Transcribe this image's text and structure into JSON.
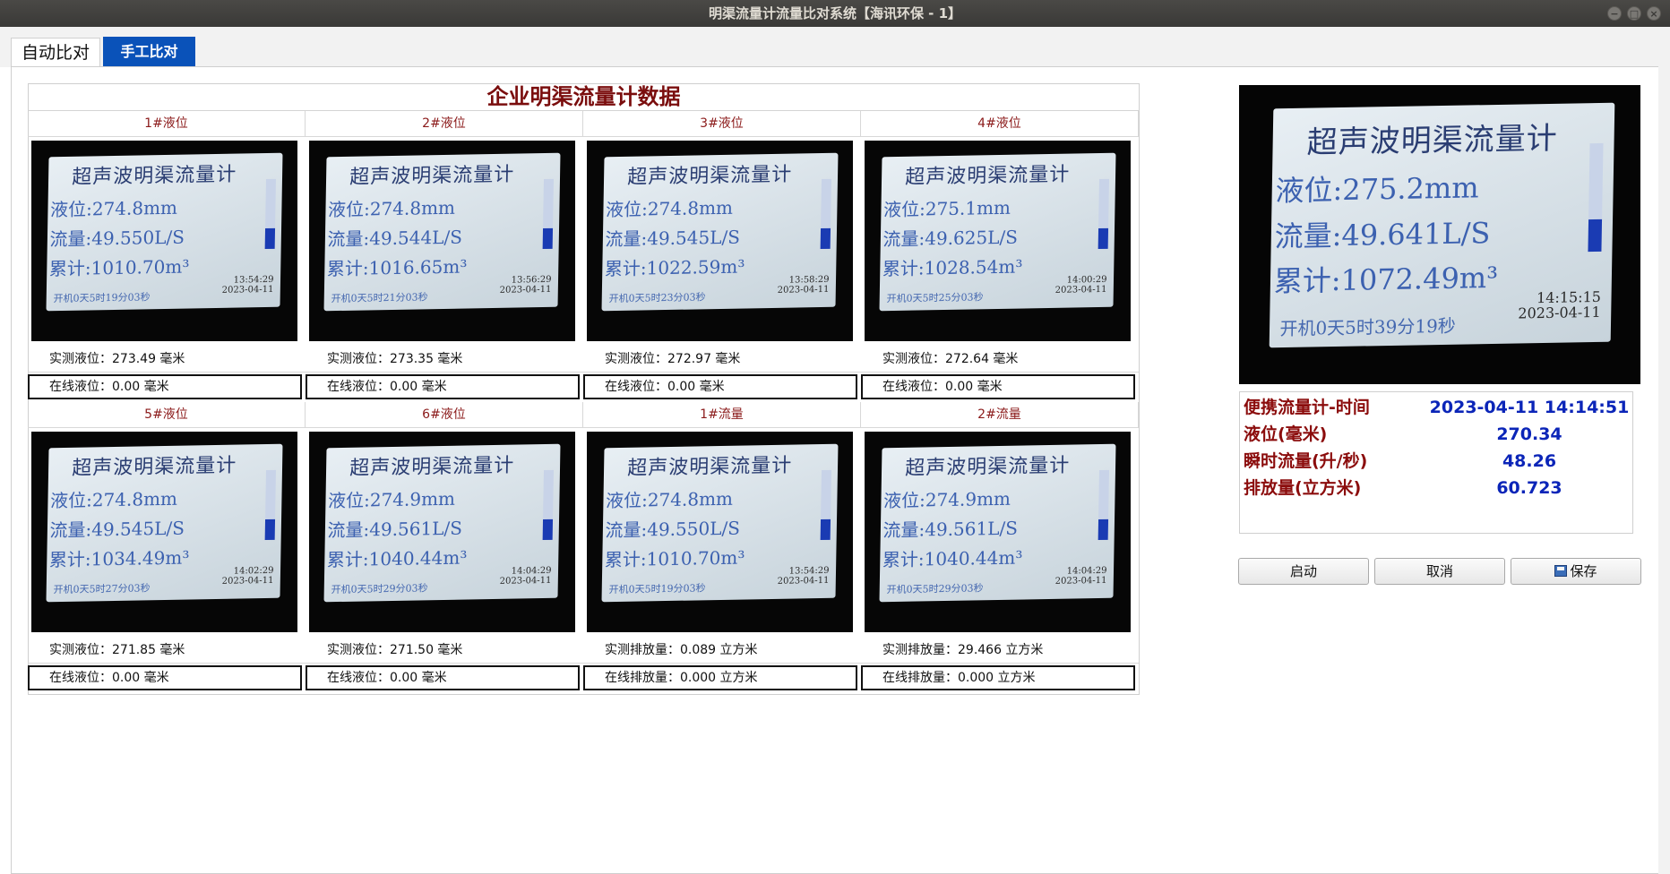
{
  "window": {
    "title": "明渠流量计流量比对系统【海讯环保 - 1】",
    "controls": [
      "−",
      "□",
      "×"
    ]
  },
  "tabs": [
    {
      "label": "自动比对"
    },
    {
      "label": "手工比对"
    }
  ],
  "grid": {
    "title": "企业明渠流量计数据",
    "cells": [
      {
        "label": "1#液位",
        "screen": {
          "title": "超声波明渠流量计",
          "level": "液位:274.8mm",
          "flow": "流量:49.550L/S",
          "total": "累计:1010.70m³",
          "uptime": "开机0天5时19分03秒",
          "time": "13:54:29",
          "date": "2023-04-11"
        },
        "measured": "实测液位：273.49  毫米",
        "online": "在线液位：0.00  毫米"
      },
      {
        "label": "2#液位",
        "screen": {
          "title": "超声波明渠流量计",
          "level": "液位:274.8mm",
          "flow": "流量:49.544L/S",
          "total": "累计:1016.65m³",
          "uptime": "开机0天5时21分03秒",
          "time": "13:56:29",
          "date": "2023-04-11"
        },
        "measured": "实测液位：273.35  毫米",
        "online": "在线液位：0.00  毫米"
      },
      {
        "label": "3#液位",
        "screen": {
          "title": "超声波明渠流量计",
          "level": "液位:274.8mm",
          "flow": "流量:49.545L/S",
          "total": "累计:1022.59m³",
          "uptime": "开机0天5时23分03秒",
          "time": "13:58:29",
          "date": "2023-04-11"
        },
        "measured": "实测液位：272.97  毫米",
        "online": "在线液位：0.00  毫米"
      },
      {
        "label": "4#液位",
        "screen": {
          "title": "超声波明渠流量计",
          "level": "液位:275.1mm",
          "flow": "流量:49.625L/S",
          "total": "累计:1028.54m³",
          "uptime": "开机0天5时25分03秒",
          "time": "14:00:29",
          "date": "2023-04-11"
        },
        "measured": "实测液位：272.64  毫米",
        "online": "在线液位：0.00  毫米"
      },
      {
        "label": "5#液位",
        "screen": {
          "title": "超声波明渠流量计",
          "level": "液位:274.8mm",
          "flow": "流量:49.545L/S",
          "total": "累计:1034.49m³",
          "uptime": "开机0天5时27分03秒",
          "time": "14:02:29",
          "date": "2023-04-11"
        },
        "measured": "实测液位：271.85  毫米",
        "online": "在线液位：0.00  毫米"
      },
      {
        "label": "6#液位",
        "screen": {
          "title": "超声波明渠流量计",
          "level": "液位:274.9mm",
          "flow": "流量:49.561L/S",
          "total": "累计:1040.44m³",
          "uptime": "开机0天5时29分03秒",
          "time": "14:04:29",
          "date": "2023-04-11"
        },
        "measured": "实测液位：271.50  毫米",
        "online": "在线液位：0.00  毫米"
      },
      {
        "label": "1#流量",
        "screen": {
          "title": "超声波明渠流量计",
          "level": "液位:274.8mm",
          "flow": "流量:49.550L/S",
          "total": "累计:1010.70m³",
          "uptime": "开机0天5时19分03秒",
          "time": "13:54:29",
          "date": "2023-04-11"
        },
        "measured": "实测排放量：0.089  立方米",
        "online": "在线排放量：0.000  立方米"
      },
      {
        "label": "2#流量",
        "screen": {
          "title": "超声波明渠流量计",
          "level": "液位:274.9mm",
          "flow": "流量:49.561L/S",
          "total": "累计:1040.44m³",
          "uptime": "开机0天5时29分03秒",
          "time": "14:04:29",
          "date": "2023-04-11"
        },
        "measured": "实测排放量：29.466  立方米",
        "online": "在线排放量：0.000  立方米"
      }
    ]
  },
  "preview": {
    "title": "超声波明渠流量计",
    "level": "液位:275.2mm",
    "flow": "流量:49.641L/S",
    "total": "累计:1072.49m³",
    "uptime": "开机0天5时39分19秒",
    "time": "14:15:15",
    "date": "2023-04-11"
  },
  "info": {
    "time_label": "便携流量计-时间",
    "time_value": "2023-04-11 14:14:51",
    "level_label": "液位(毫米)",
    "level_value": "270.34",
    "flow_label": "瞬时流量(升/秒)",
    "flow_value": "48.26",
    "volume_label": "排放量(立方米)",
    "volume_value": "60.723"
  },
  "buttons": {
    "start": "启动",
    "cancel": "取消",
    "save": "保存"
  },
  "colors": {
    "title_red": "#7a0d0d",
    "label_red": "#8b1a1a",
    "value_blue": "#0b25b8",
    "tab_active_blue": "#0a52b9"
  }
}
